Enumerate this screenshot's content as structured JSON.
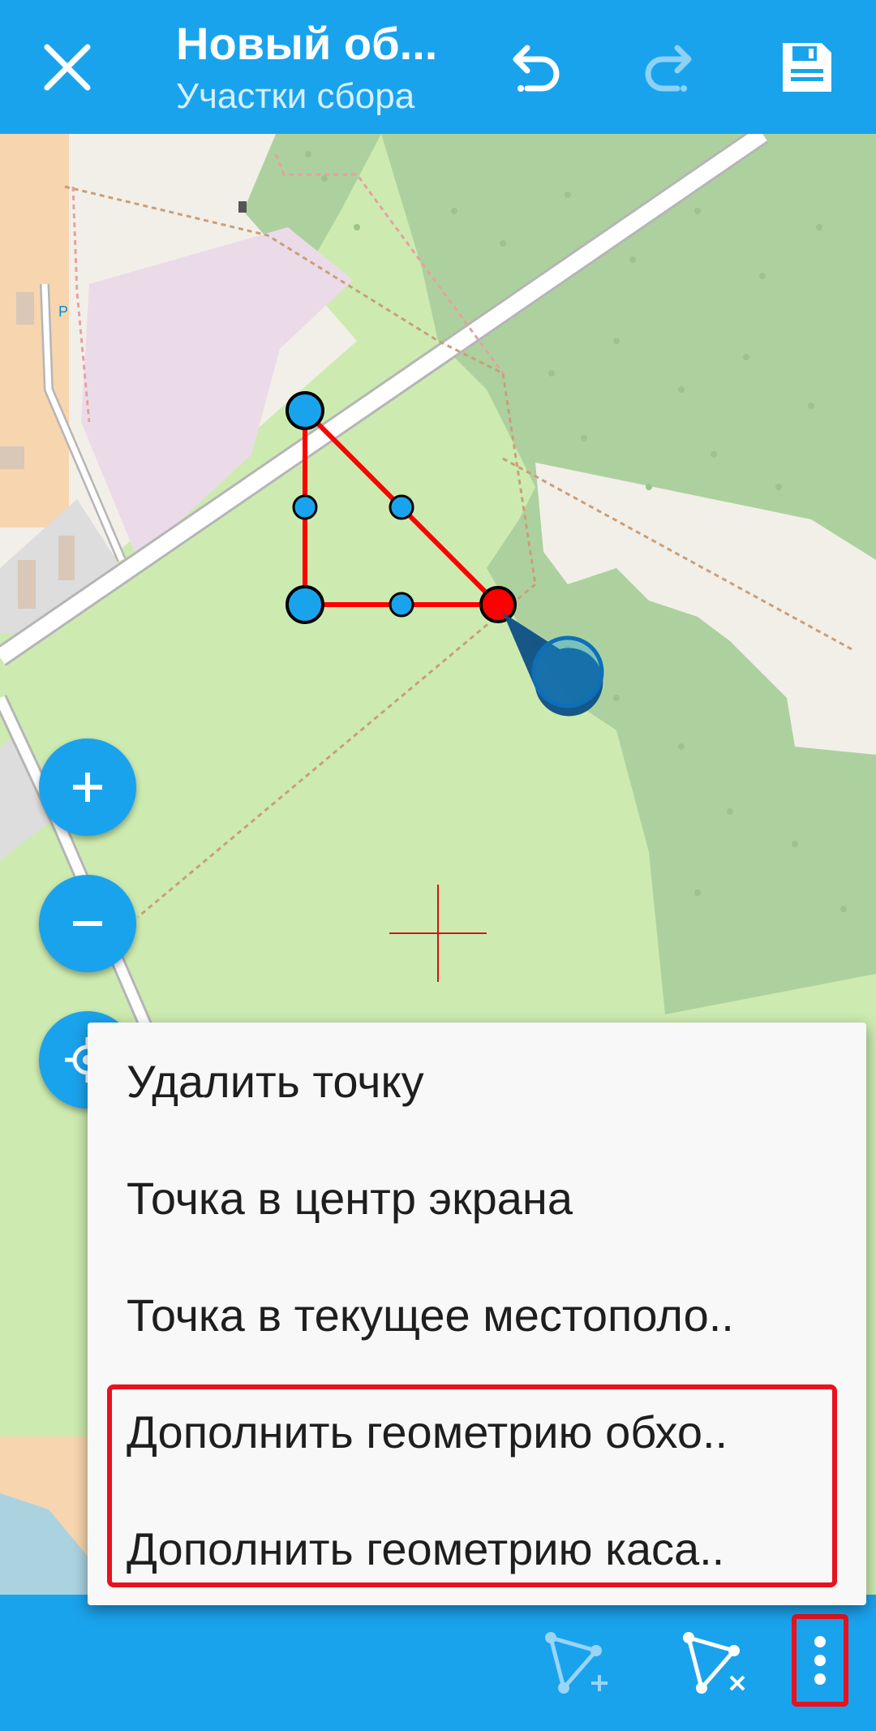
{
  "topbar": {
    "title": "Новый об...",
    "subtitle": "Участки сбора",
    "close_icon": "close-icon",
    "undo_icon": "undo-icon",
    "redo_icon": "redo-icon",
    "save_icon": "save-icon"
  },
  "map": {
    "parking_label": "P",
    "colors": {
      "polygon_edge": "#ff0000",
      "vertex": "#1aa3ed",
      "selected_vertex": "#ff0000",
      "forest": "#add19e",
      "meadow": "#cdebb0",
      "residential": "#f2efe9",
      "industrial": "#ebdbe8"
    }
  },
  "zoom_controls": {
    "zoom_in_icon": "plus-icon",
    "zoom_out_icon": "minus-icon",
    "locate_icon": "crosshair-location-icon"
  },
  "menu": {
    "items": [
      "Удалить точку",
      "Точка в центр экрана",
      "Точка в текущее местополо..",
      "Дополнить геометрию обхо..",
      "Дополнить геометрию каса.."
    ],
    "highlight_color": "#e8121f"
  },
  "bottombar": {
    "add_geometry_icon": "add-geometry-icon",
    "delete_geometry_icon": "delete-geometry-icon",
    "more_icon": "more-vert-icon"
  }
}
